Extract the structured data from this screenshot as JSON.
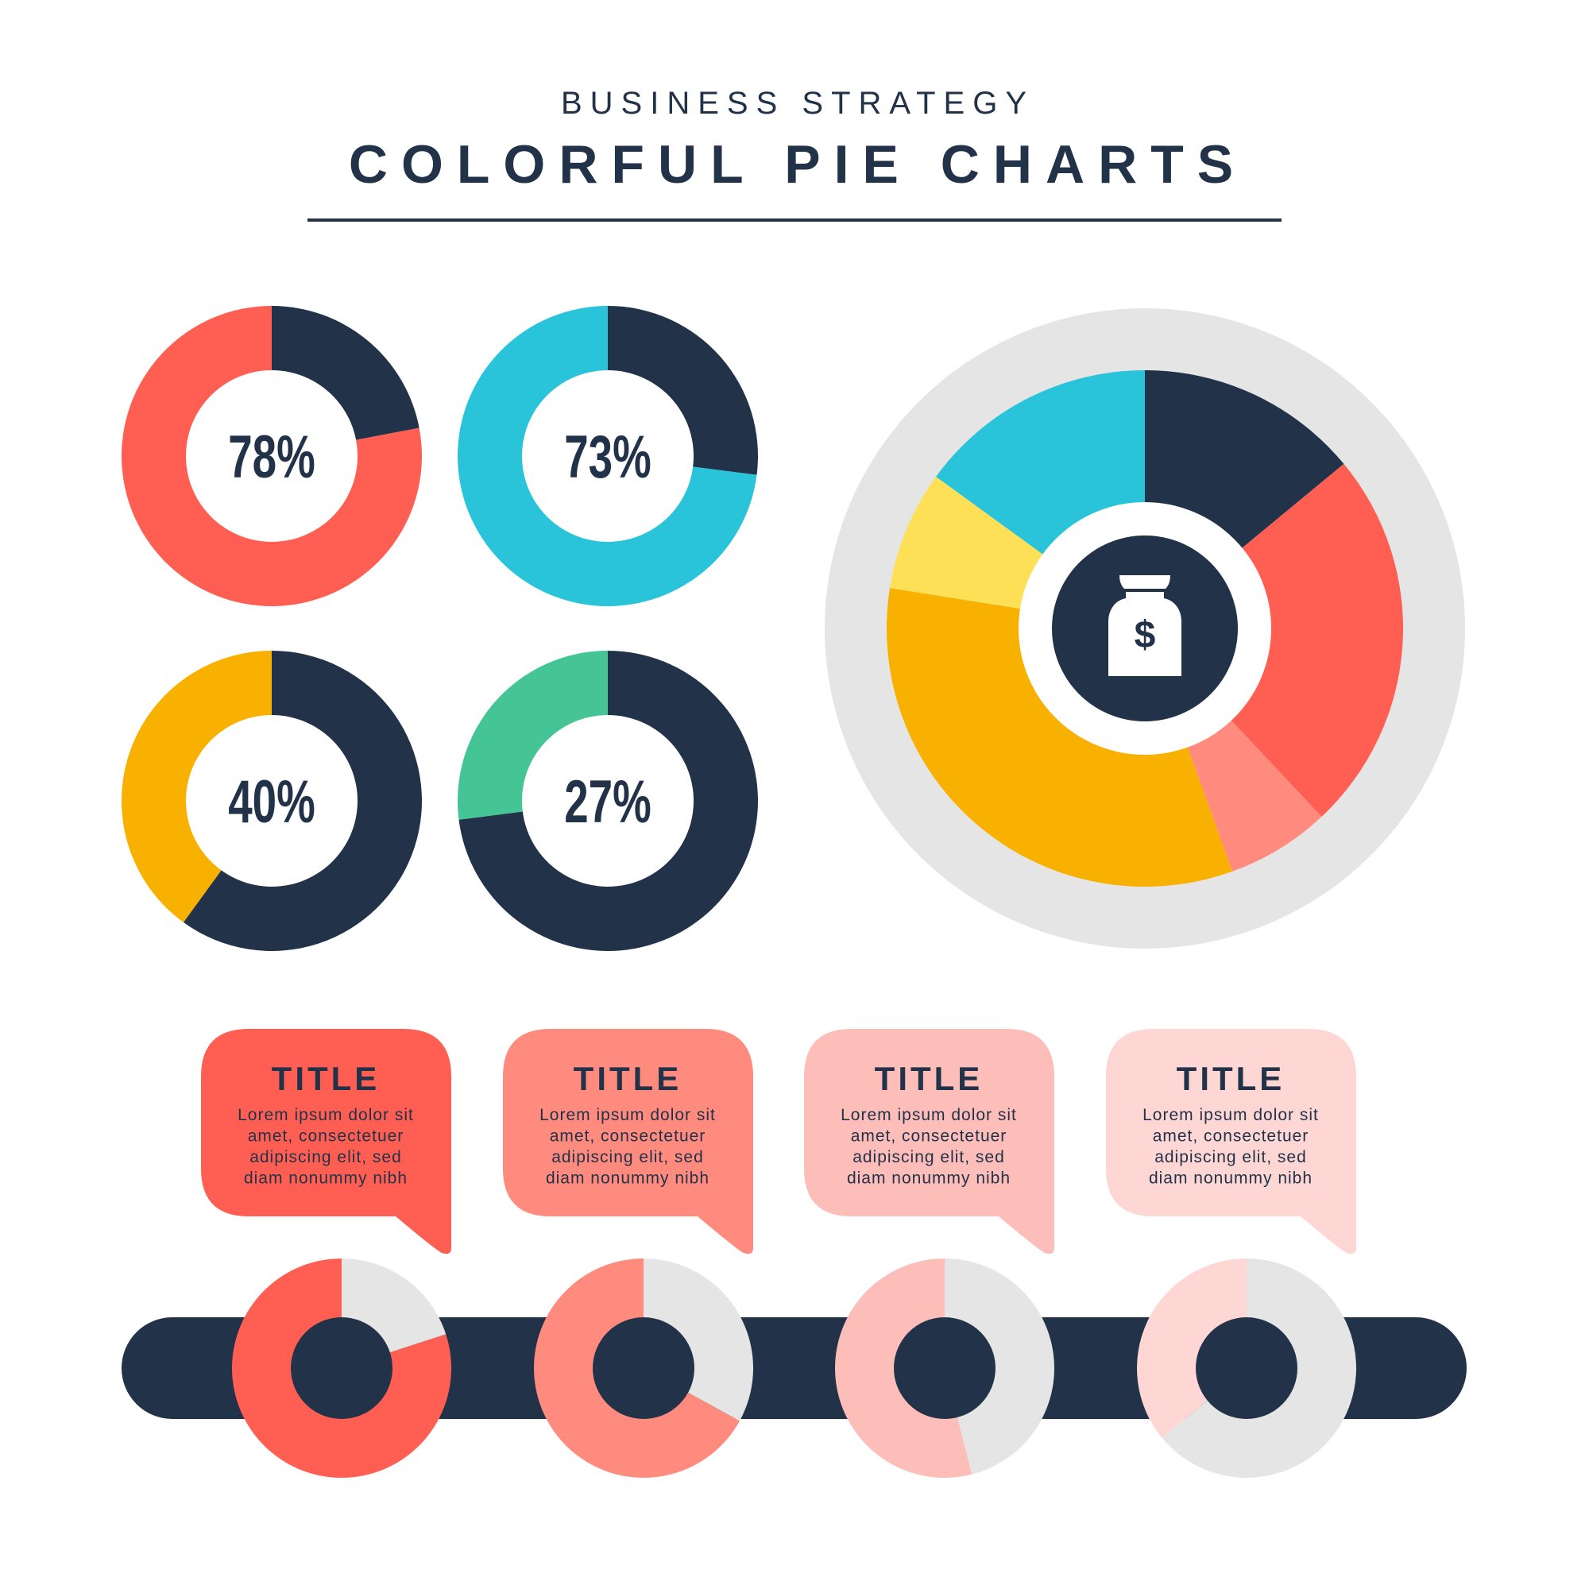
{
  "header": {
    "subtitle": "BUSINESS STRATEGY",
    "title": "COLORFUL PIE CHARTS"
  },
  "colors": {
    "dark": "#223249",
    "red": "#FF5F52",
    "cyan": "#29C4D9",
    "orange": "#F8B100",
    "green": "#45C496",
    "yellow": "#FEE057",
    "salmon": "#FF8A7E",
    "gray": "#E5E5E5",
    "pink": "#FDBDB8",
    "light_pink": "#FED7D4"
  },
  "chart_data": [
    {
      "type": "pie",
      "label": "78%",
      "value": 78,
      "color": "#FF5F52",
      "rest_color": "#223249"
    },
    {
      "type": "pie",
      "label": "73%",
      "value": 73,
      "color": "#29C4D9",
      "rest_color": "#223249"
    },
    {
      "type": "pie",
      "label": "40%",
      "value": 40,
      "color": "#F8B100",
      "rest_color": "#223249"
    },
    {
      "type": "pie",
      "label": "27%",
      "value": 27,
      "color": "#45C496",
      "rest_color": "#223249"
    },
    {
      "type": "pie",
      "center_icon": "money-bag-icon",
      "slices": [
        {
          "value": 14,
          "color": "#223249"
        },
        {
          "value": 24,
          "color": "#FF5F52"
        },
        {
          "value": 6.5,
          "color": "#FF8A7E"
        },
        {
          "value": 33,
          "color": "#F8B100"
        },
        {
          "value": 7.5,
          "color": "#FEE057"
        },
        {
          "value": 15,
          "color": "#29C4D9"
        }
      ]
    },
    {
      "type": "pie",
      "value": 80,
      "color": "#FF5F52",
      "rest_color": "#E5E5E5"
    },
    {
      "type": "pie",
      "value": 67,
      "color": "#FF8A7E",
      "rest_color": "#E5E5E5"
    },
    {
      "type": "pie",
      "value": 54,
      "color": "#FDBDB8",
      "rest_color": "#E5E5E5"
    },
    {
      "type": "pie",
      "value": 36,
      "color": "#FED7D4",
      "rest_color": "#E5E5E5"
    }
  ],
  "callouts": [
    {
      "title": "TITLE",
      "lines": [
        "Lorem ipsum dolor sit",
        "amet, consectetuer",
        "adipiscing elit, sed",
        "diam nonummy nibh"
      ],
      "color": "#FF5F52"
    },
    {
      "title": "TITLE",
      "lines": [
        "Lorem ipsum dolor sit",
        "amet, consectetuer",
        "adipiscing elit, sed",
        "diam nonummy nibh"
      ],
      "color": "#FF8A7E"
    },
    {
      "title": "TITLE",
      "lines": [
        "Lorem ipsum dolor sit",
        "amet, consectetuer",
        "adipiscing elit, sed",
        "diam nonummy nibh"
      ],
      "color": "#FDBDB8"
    },
    {
      "title": "TITLE",
      "lines": [
        "Lorem ipsum dolor sit",
        "amet, consectetuer",
        "adipiscing elit, sed",
        "diam nonummy nibh"
      ],
      "color": "#FED7D4"
    }
  ]
}
